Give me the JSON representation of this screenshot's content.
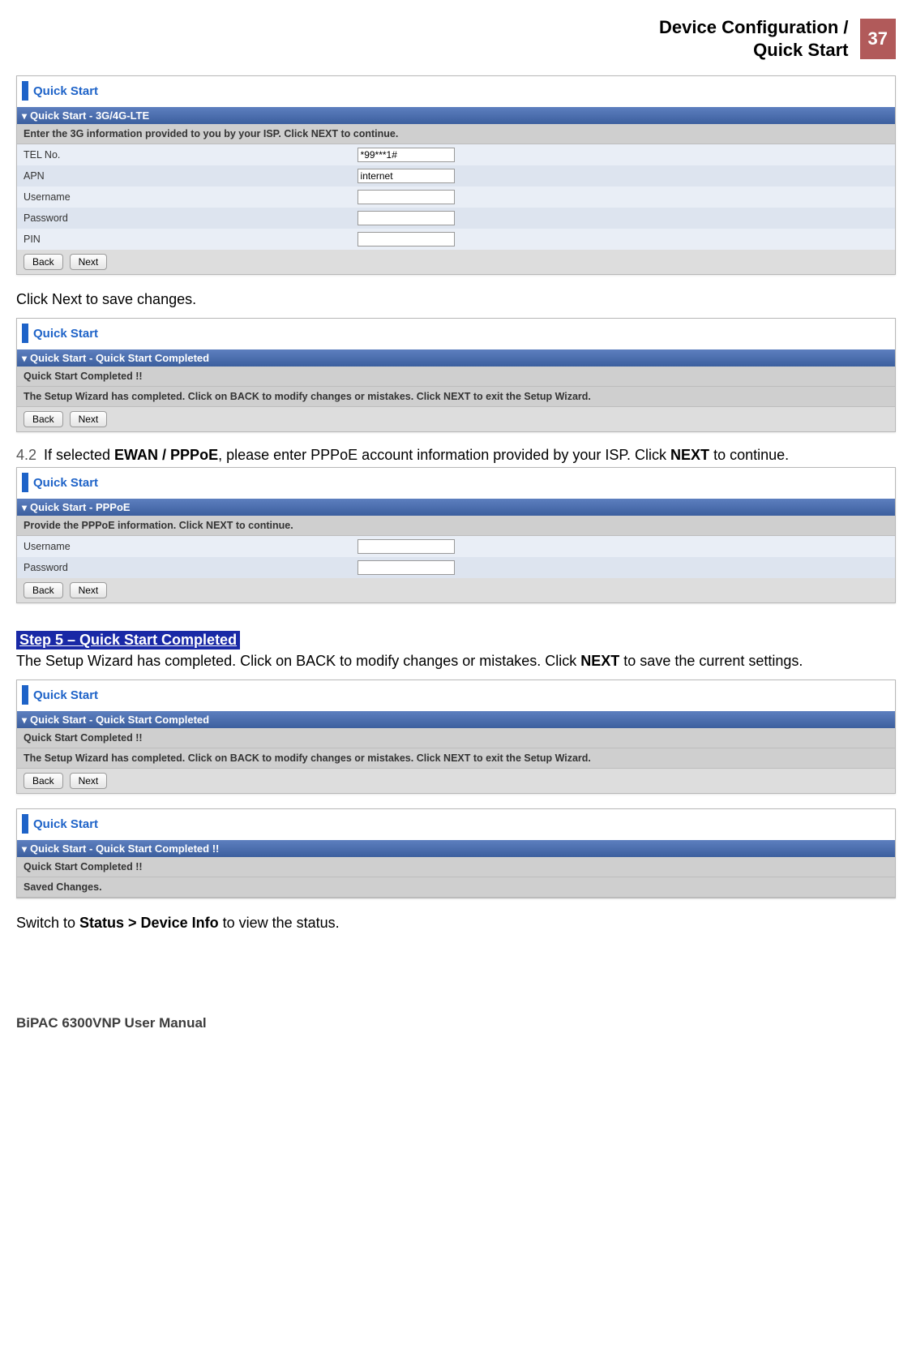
{
  "header": {
    "title_line1": "Device Configuration /",
    "title_line2": "Quick Start",
    "page_number": "37"
  },
  "panel1": {
    "title": "Quick Start",
    "section_title": "Quick Start - 3G/4G-LTE",
    "instruction": "Enter the 3G information provided to you by your ISP. Click NEXT to continue.",
    "fields": [
      {
        "label": "TEL No.",
        "value": "*99***1#"
      },
      {
        "label": "APN",
        "value": "internet"
      },
      {
        "label": "Username",
        "value": ""
      },
      {
        "label": "Password",
        "value": ""
      },
      {
        "label": "PIN",
        "value": ""
      }
    ],
    "back": "Back",
    "next": "Next"
  },
  "text1": "Click Next to save changes.",
  "panel2": {
    "title": "Quick Start",
    "section_title": "Quick Start - Quick Start Completed",
    "completed": "Quick Start Completed !!",
    "instruction": "The Setup Wizard has completed. Click on BACK to modify changes or mistakes. Click NEXT to exit the Setup Wizard.",
    "back": "Back",
    "next": "Next"
  },
  "numbered": {
    "num": "4.2",
    "pre": "If selected ",
    "bold1": "EWAN / PPPoE",
    "mid": ", please enter PPPoE account information provided by your ISP. Click ",
    "bold2": "NEXT",
    "post": " to continue."
  },
  "panel3": {
    "title": "Quick Start",
    "section_title": "Quick Start - PPPoE",
    "instruction": "Provide the PPPoE information. Click NEXT to continue.",
    "fields": [
      {
        "label": "Username",
        "value": ""
      },
      {
        "label": "Password",
        "value": ""
      }
    ],
    "back": "Back",
    "next": "Next"
  },
  "step5": {
    "banner": "Step 5 – Quick Start Completed",
    "text_pre": "The Setup Wizard has completed. Click on BACK to modify changes or mistakes. Click ",
    "text_bold": "NEXT",
    "text_post": " to save the current settings."
  },
  "panel4": {
    "title": "Quick Start",
    "section_title": "Quick Start - Quick Start Completed",
    "completed": "Quick Start Completed !!",
    "instruction": "The Setup Wizard has completed. Click on BACK to modify changes or mistakes. Click NEXT to exit the Setup Wizard.",
    "back": "Back",
    "next": "Next"
  },
  "panel5": {
    "title": "Quick Start",
    "section_title": "Quick Start - Quick Start Completed !!",
    "completed": "Quick Start Completed !!",
    "saved": "Saved Changes."
  },
  "text2": {
    "pre": "Switch to ",
    "bold": "Status > Device Info",
    "post": " to view the status."
  },
  "footer": "BiPAC 6300VNP User Manual"
}
